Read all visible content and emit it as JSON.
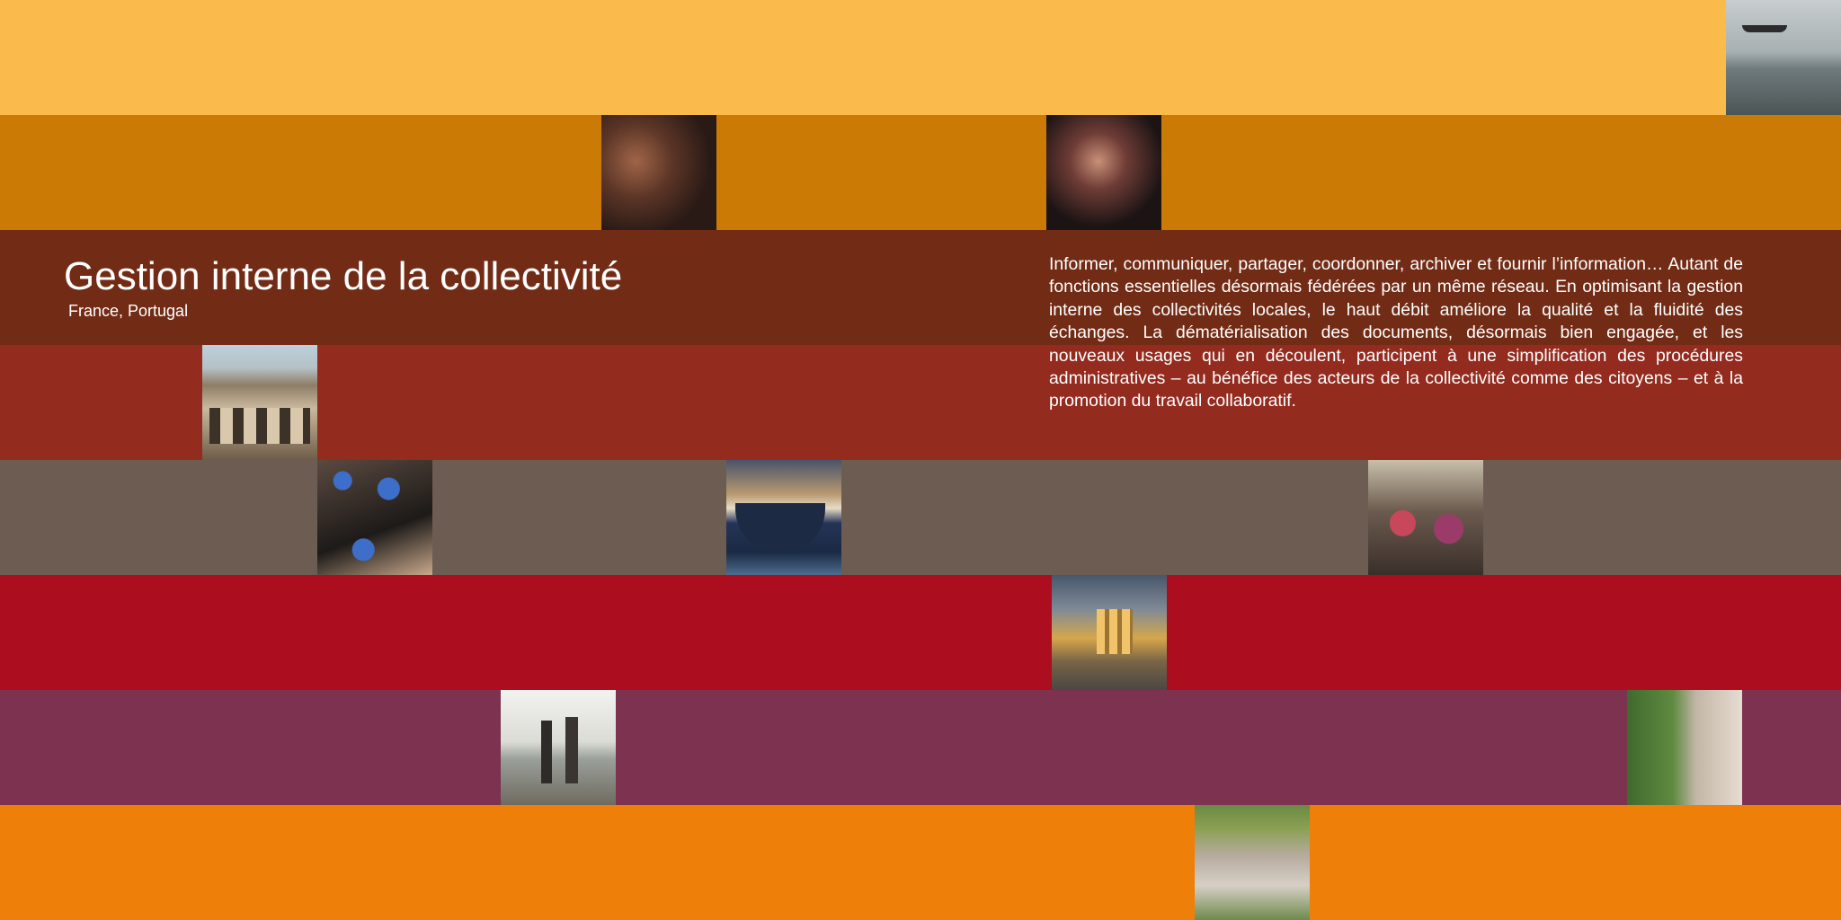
{
  "page": {
    "title": "Gestion interne de la collectivité",
    "subtitle": "France, Portugal",
    "body": "Informer, communiquer, partager, coordonner, archiver et fournir l’information… Autant de fonctions essentielles désormais fédérées par un même réseau. En optimisant la gestion interne des collectivités locales, le haut débit améliore la qualité et la fluidité des échanges. La dématérialisation des documents, désormais bien engagée, et les nouveaux usages qui en découlent, participent à une simplification des procédures administratives – au bénéfice des acteurs de la collectivité comme des citoyens – et à la promotion du travail collaboratif."
  },
  "bands": [
    {
      "color": "#fbbb4c"
    },
    {
      "color": "#cb7a06"
    },
    {
      "color": "#722c16"
    },
    {
      "color": "#932b1f"
    },
    {
      "color": "#6d5c52"
    },
    {
      "color": "#ad0e1f"
    },
    {
      "color": "#7d3250"
    },
    {
      "color": "#ee7f08"
    }
  ]
}
